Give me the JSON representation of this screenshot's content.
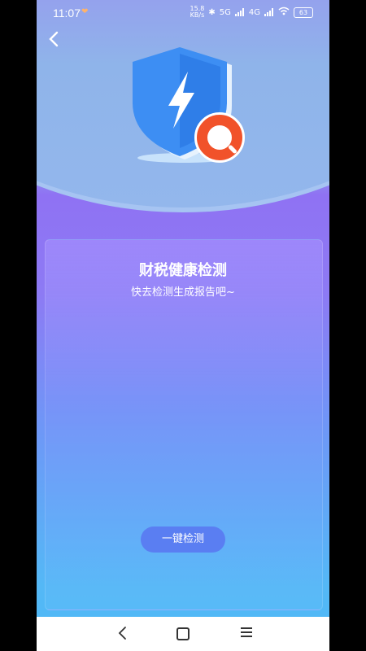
{
  "status_bar": {
    "time": "11:07",
    "net_speed_value": "15.8",
    "net_speed_unit": "KB/s",
    "signal_1_label": "5G",
    "signal_2_label": "4G",
    "battery": "63"
  },
  "header": {
    "back_icon": "chevron-left-icon",
    "hero_icon": "shield-lightning-icon",
    "badge_icon": "search-icon"
  },
  "card": {
    "title": "财税健康检测",
    "subtitle": "快去检测生成报告吧~",
    "button_label": "一键检测"
  },
  "nav_bar": {
    "items": [
      "back",
      "home",
      "recent-apps"
    ]
  },
  "colors": {
    "accent": "#5a7ef2",
    "shield": "#3d8ef3",
    "badge": "#f1522a"
  }
}
